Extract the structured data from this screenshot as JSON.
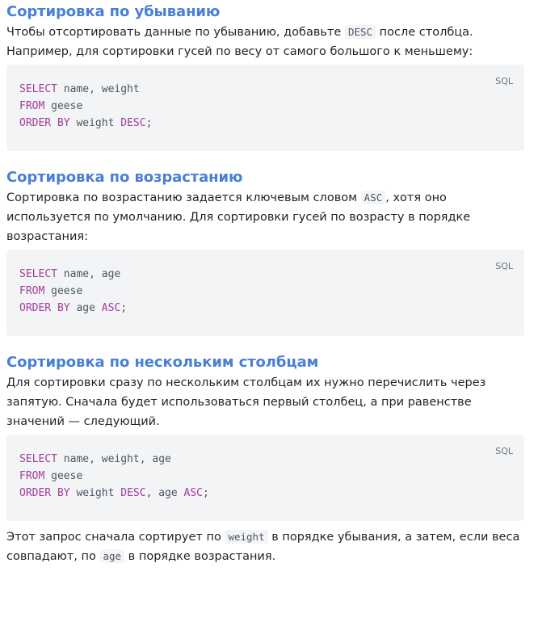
{
  "sections": [
    {
      "title": "Сортировка по убыванию",
      "text": {
        "before": "Чтобы отсортировать данные по убыванию, добавьте ",
        "code": "DESC",
        "after": " после столбца. Например, для сортировки гусей по весу от самого большого к меньшему:"
      },
      "lang": "SQL",
      "code": {
        "l1_kw": "SELECT",
        "l1_rest": " name, weight",
        "l2_kw": "FROM",
        "l2_rest": " geese",
        "l3_kw": "ORDER BY",
        "l3_rest": " weight ",
        "l3_kw2": "DESC",
        "l3_end": ";"
      }
    },
    {
      "title": "Сортировка по возрастанию",
      "text": {
        "before": "Сортировка по возрастанию задается ключевым словом ",
        "code": "ASC",
        "after": ", хотя оно используется по умолчанию. Для сортировки гусей по возрасту в порядке возрастания:"
      },
      "lang": "SQL",
      "code": {
        "l1_kw": "SELECT",
        "l1_rest": " name, age",
        "l2_kw": "FROM",
        "l2_rest": " geese",
        "l3_kw": "ORDER BY",
        "l3_rest": " age ",
        "l3_kw2": "ASC",
        "l3_end": ";"
      }
    },
    {
      "title": "Сортировка по нескольким столбцам",
      "text": "Для сортировки сразу по нескольким столбцам их нужно перечислить через запятую. Сначала будет использоваться первый столбец, а при равенстве значений — следующий.",
      "lang": "SQL",
      "code": {
        "l1_kw": "SELECT",
        "l1_rest": " name, weight, age",
        "l2_kw": "FROM",
        "l2_rest": " geese",
        "l3_kw": "ORDER BY",
        "l3_rest": " weight ",
        "l3_kw2": "DESC",
        "l3_mid": ", age ",
        "l3_kw3": "ASC",
        "l3_end": ";"
      }
    }
  ],
  "footer": {
    "p1": "Этот запрос сначала сортирует по ",
    "c1": "weight",
    "p2": " в порядке убывания, а затем, если веса совпадают, по ",
    "c2": "age",
    "p3": " в порядке возрастания."
  },
  "colors": {
    "heading": "#4a7fd6",
    "keyword": "#a23c9a",
    "code_bg": "#f3f4f6"
  }
}
